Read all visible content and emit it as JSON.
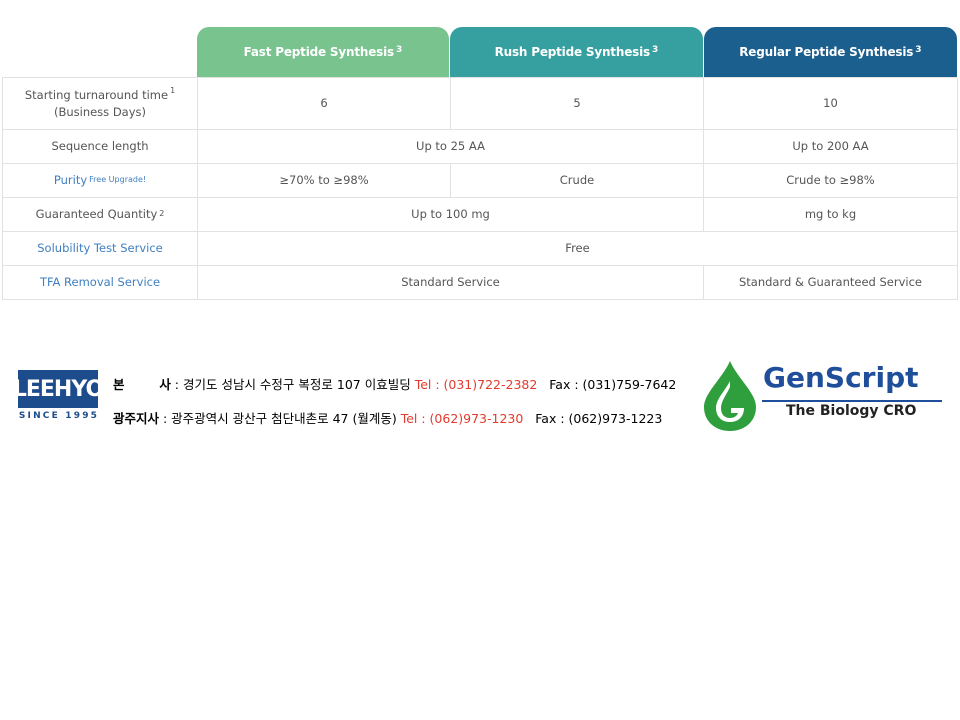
{
  "table": {
    "headers": [
      {
        "label": "Fast Peptide Synthesis",
        "sup": "3"
      },
      {
        "label": "Rush Peptide Synthesis",
        "sup": "3"
      },
      {
        "label": "Regular Peptide Synthesis",
        "sup": "3"
      }
    ],
    "rows": {
      "turnaround": {
        "label_line1": "Starting turnaround time",
        "sup": "1",
        "label_line2": "(Business Days)",
        "fast": "6",
        "rush": "5",
        "regular": "10"
      },
      "sequence": {
        "label": "Sequence length",
        "fast_rush": "Up to 25 AA",
        "regular": "Up to 200 AA"
      },
      "purity": {
        "label": "Purity",
        "sup": "Free Upgrade!",
        "fast": "≥70% to ≥98%",
        "rush": "Crude",
        "regular": "Crude to ≥98%"
      },
      "quantity": {
        "label": "Guaranteed Quantity",
        "sup": "2",
        "fast_rush": "Up to 100 mg",
        "regular": "mg to kg"
      },
      "solubility": {
        "label": "Solubility Test Service",
        "all": "Free"
      },
      "tfa": {
        "label": "TFA Removal Service",
        "fast_rush": "Standard Service",
        "regular": "Standard & Guaranteed Service"
      }
    }
  },
  "footer": {
    "leehyo_logo": "LEEHYO",
    "leehyo_since": "SINCE 1995",
    "hq": {
      "title": "본        사",
      "address": " : 경기도 성남시 수정구 복정로 107 이효빌딩 ",
      "tel": "Tel : (031)722-2382",
      "fax": "Fax : (031)759-7642"
    },
    "branch": {
      "title": "광주지사",
      "address": " : 광주광역시 광산구 첨단내촌로 47 (월계동) ",
      "tel": "Tel : (062)973-1230",
      "fax": "Fax : (062)973-1223"
    },
    "genscript_logo": "GenScript",
    "genscript_tagline": "The Biology CRO",
    "colors": {
      "green": "#2f9e3c",
      "blue": "#1f4e9a",
      "red": "#e23b2e"
    }
  }
}
